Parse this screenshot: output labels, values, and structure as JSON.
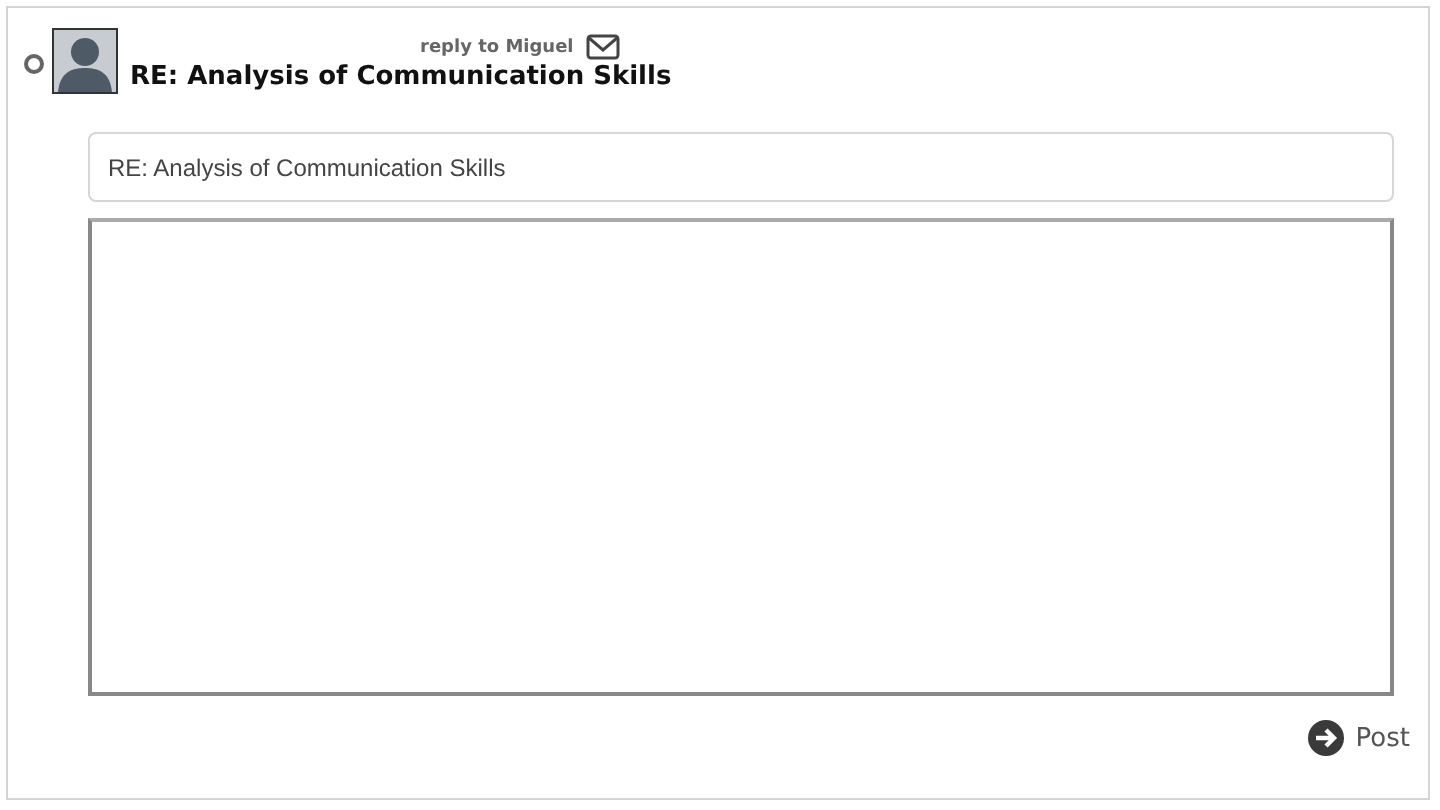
{
  "post": {
    "radio": {
      "selected": false
    },
    "reply_to": "reply to Miguel",
    "title": "RE: Analysis of Communication Skills"
  },
  "form": {
    "subject": "RE: Analysis of Communication Skills",
    "submit": "Post"
  }
}
